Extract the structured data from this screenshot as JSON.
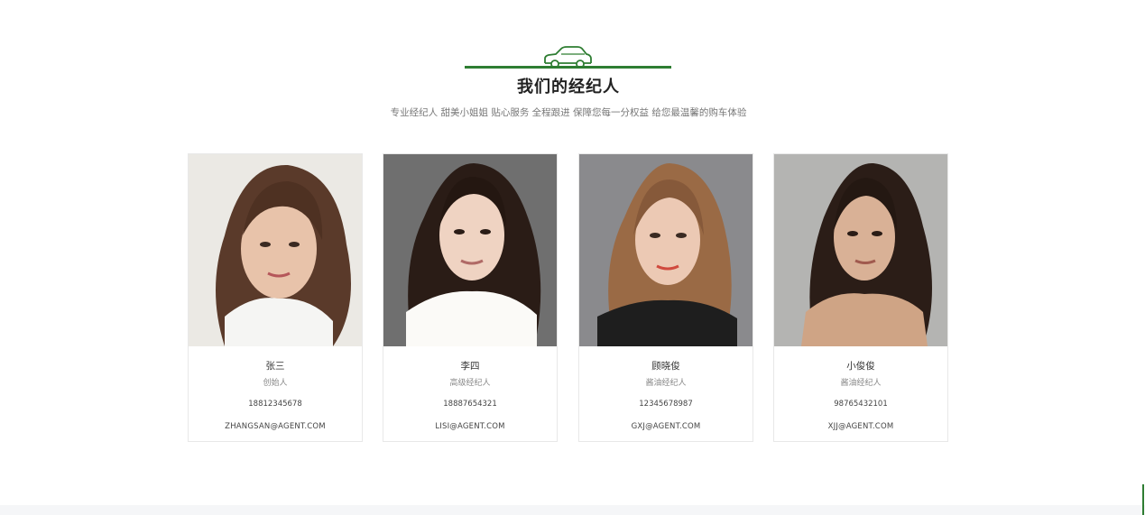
{
  "section": {
    "title": "我们的经纪人",
    "subtitle": "专业经纪人 甜美小姐姐 贴心服务 全程跟进 保障您每一分权益 给您最温馨的购车体验",
    "accent_color": "#2e7d32",
    "title_icon": "car-icon"
  },
  "agents": [
    {
      "name": "张三",
      "role": "创始人",
      "phone": "18812345678",
      "email": "ZHANGSAN@AGENT.COM"
    },
    {
      "name": "李四",
      "role": "高级经纪人",
      "phone": "18887654321",
      "email": "LISI@AGENT.COM"
    },
    {
      "name": "顾晓俊",
      "role": "酱油经纪人",
      "phone": "12345678987",
      "email": "GXJ@AGENT.COM"
    },
    {
      "name": "小俊俊",
      "role": "酱油经纪人",
      "phone": "98765432101",
      "email": "XJJ@AGENT.COM"
    }
  ]
}
